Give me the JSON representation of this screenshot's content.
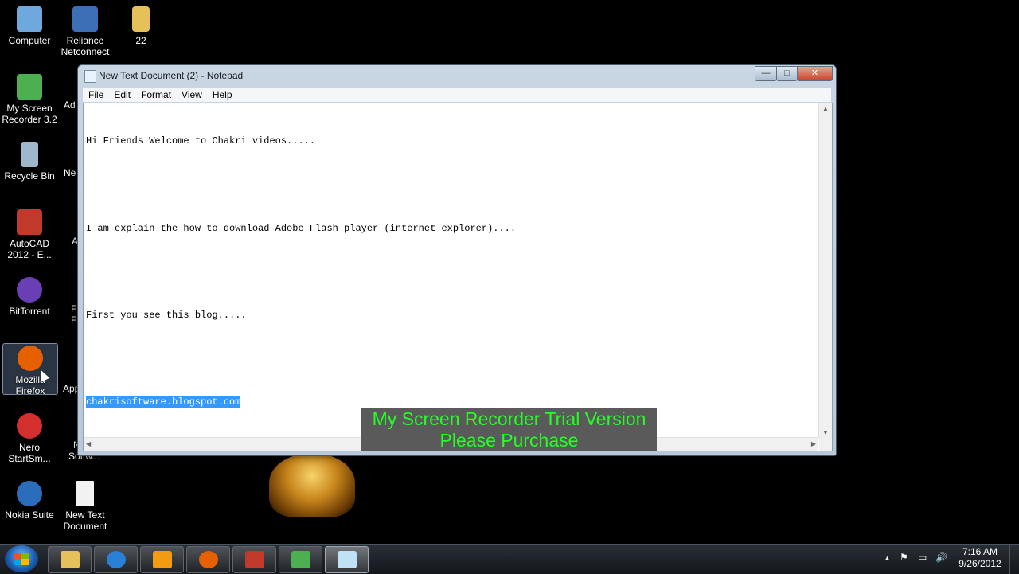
{
  "desktop": {
    "icons": [
      {
        "label": "Computer",
        "icon": "computer-icon",
        "color": "#6fa8dc"
      },
      {
        "label": "Reliance Netconnect",
        "icon": "reliance-netconnect-icon",
        "color": "#3b6fb6"
      },
      {
        "label": "22",
        "icon": "folder-icon",
        "color": "#e6c15a"
      },
      {
        "label": "My Screen Recorder 3.2",
        "icon": "screen-recorder-icon",
        "color": "#4caf50"
      },
      {
        "label": "Recycle Bin",
        "icon": "recycle-bin-icon",
        "color": "#9fb8cc"
      },
      {
        "label": "AutoCAD 2012 - E...",
        "icon": "autocad-icon",
        "color": "#c0392b"
      },
      {
        "label": "BitTorrent",
        "icon": "bittorrent-icon",
        "color": "#6a3fb5"
      },
      {
        "label": "Mozilla Firefox",
        "icon": "firefox-icon",
        "color": "#e66000"
      },
      {
        "label": "Nero StartSm...",
        "icon": "nero-icon",
        "color": "#d32f2f"
      },
      {
        "label": "Nokia Suite",
        "icon": "nokia-suite-icon",
        "color": "#2a6ebb"
      },
      {
        "label": "New Text Document",
        "icon": "text-document-icon",
        "color": "#f2f2f2"
      }
    ],
    "partial_labels": [
      "Ad",
      "Ne",
      "A",
      "F",
      "F",
      "App",
      "N",
      "Softw..."
    ]
  },
  "notepad": {
    "title": "New Text Document (2) - Notepad",
    "controls": {
      "minimize": "—",
      "maximize": "□",
      "close": "✕"
    },
    "menu": [
      "File",
      "Edit",
      "Format",
      "View",
      "Help"
    ],
    "lines": [
      "Hi Friends Welcome to Chakri videos.....",
      "",
      "I am explain the how to download Adobe Flash player (internet explorer)....",
      "",
      "First you see this blog.....",
      ""
    ],
    "selected_line": "chakrisoftware.blogspot.com",
    "selection_color": "#3399ff"
  },
  "watermark": {
    "line1": "My Screen Recorder Trial Version",
    "line2": "Please Purchase",
    "color": "#22ff22"
  },
  "taskbar": {
    "buttons": [
      {
        "name": "windows-explorer",
        "icon": "folder-icon",
        "color": "#e6c15a"
      },
      {
        "name": "internet-explorer",
        "icon": "internet-explorer-icon",
        "color": "#2a7fd6"
      },
      {
        "name": "media-player",
        "icon": "media-player-icon",
        "color": "#f39c12"
      },
      {
        "name": "firefox",
        "icon": "firefox-icon",
        "color": "#e66000"
      },
      {
        "name": "adobe-reader",
        "icon": "adobe-reader-icon",
        "color": "#c0392b"
      },
      {
        "name": "screen-recorder",
        "icon": "screen-recorder-icon",
        "color": "#4caf50"
      },
      {
        "name": "notepad",
        "icon": "notepad-icon",
        "color": "#bfe3f5",
        "active": true
      }
    ],
    "tray": {
      "show_hidden": "▲",
      "flag": "⚑",
      "network": "▭",
      "volume": "🔊"
    },
    "clock": {
      "time": "7:16 AM",
      "date": "9/26/2012"
    }
  }
}
